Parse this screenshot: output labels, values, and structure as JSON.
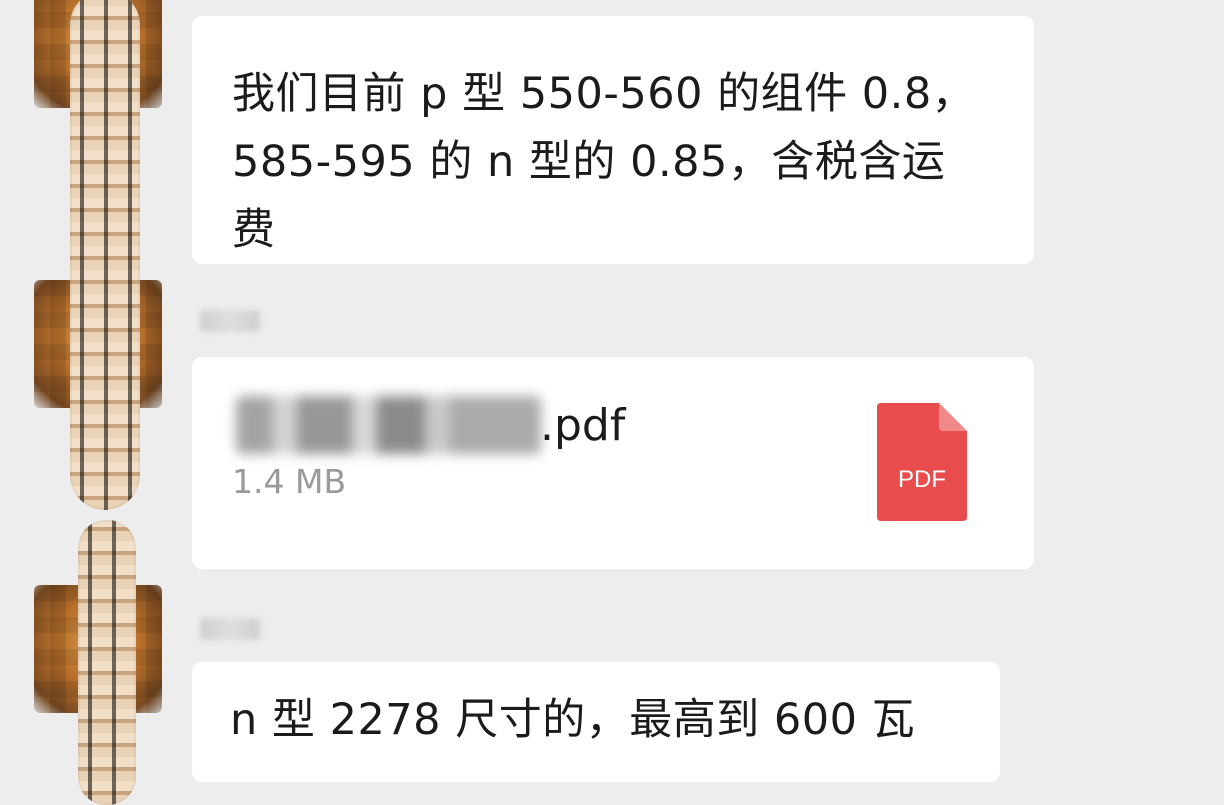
{
  "messages": [
    {
      "type": "text",
      "lines": [
        "我们目前 p 型 550-560 的组件 0.8，",
        "585-595 的 n 型的 0.85，含税含运",
        "费"
      ]
    },
    {
      "type": "file",
      "file_name_visible": ".pdf",
      "file_size": "1.4 MB",
      "file_icon_label": "PDF",
      "file_icon_color": "#e84c4c"
    },
    {
      "type": "text",
      "lines": [
        "n 型 2278 尺寸的，最高到 600 瓦"
      ]
    }
  ],
  "colors": {
    "background": "#ededed",
    "bubble": "#ffffff",
    "text": "#1b1b1b",
    "secondary_text": "#9a9a9a"
  }
}
